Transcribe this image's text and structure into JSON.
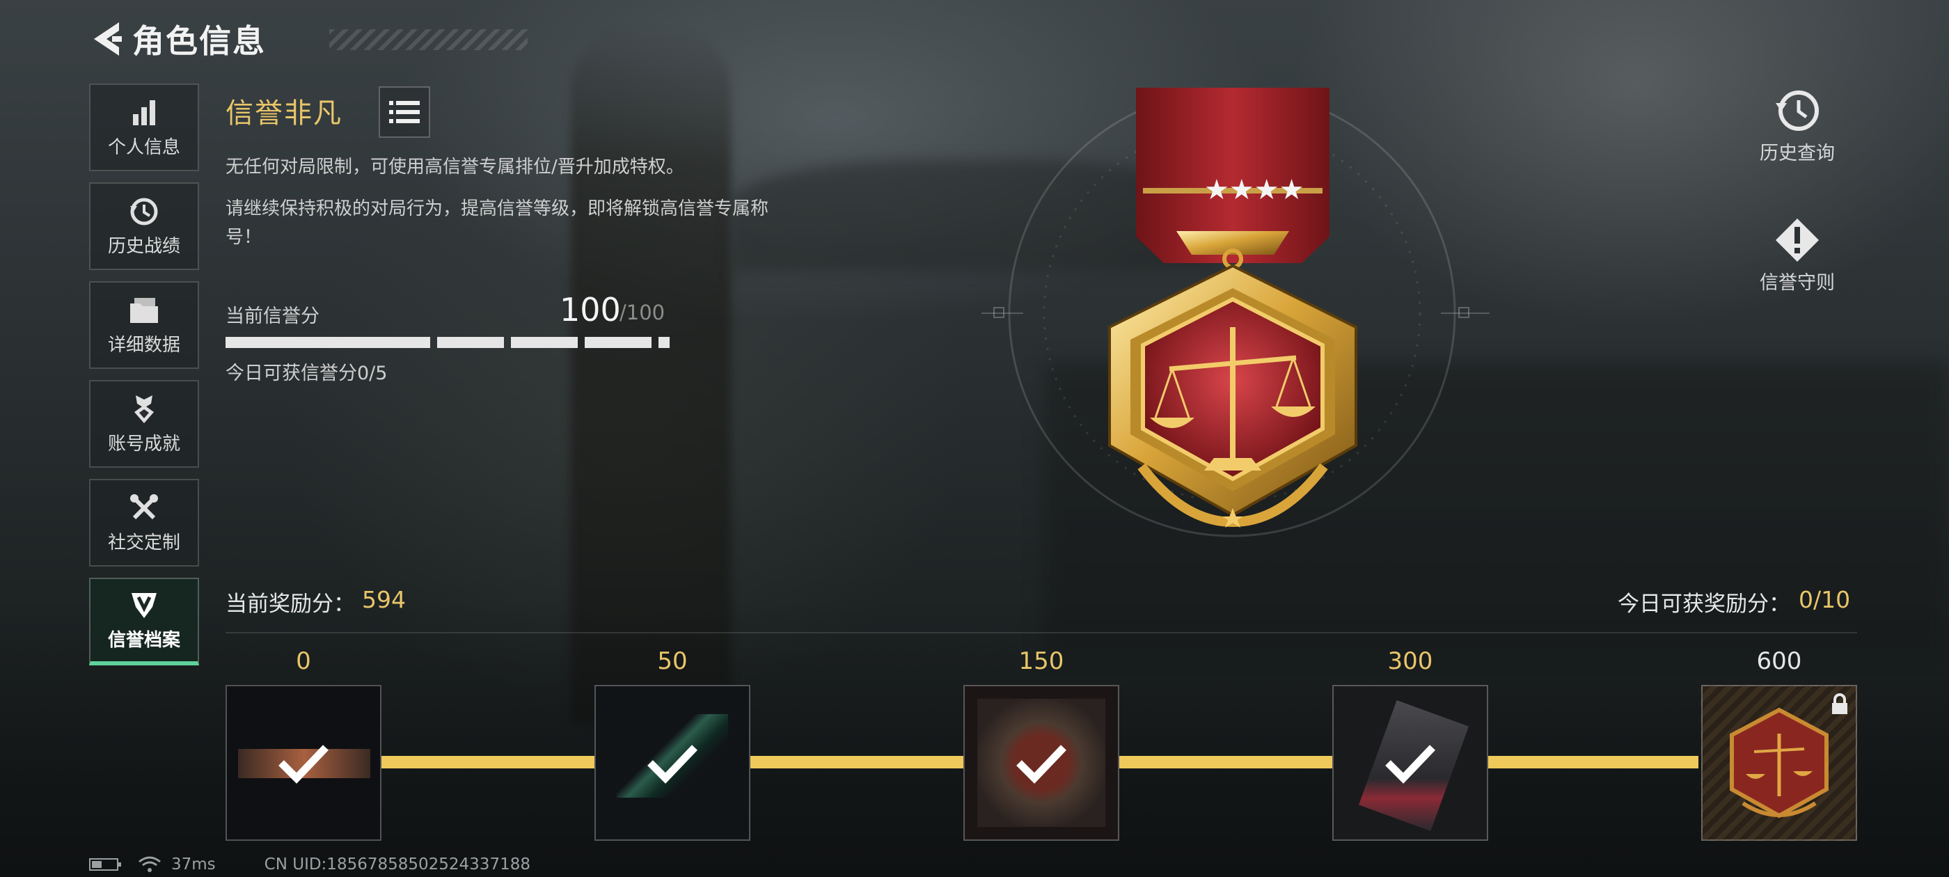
{
  "header": {
    "title": "角色信息"
  },
  "sidebar": {
    "items": [
      {
        "label": "个人信息",
        "icon": "bar-chart-icon"
      },
      {
        "label": "历史战绩",
        "icon": "history-icon"
      },
      {
        "label": "详细数据",
        "icon": "folder-icon"
      },
      {
        "label": "账号成就",
        "icon": "achievement-icon"
      },
      {
        "label": "社交定制",
        "icon": "tools-icon"
      },
      {
        "label": "信誉档案",
        "icon": "credit-shield-icon",
        "active": true
      }
    ]
  },
  "credit": {
    "rank_title": "信誉非凡",
    "desc1": "无任何对局限制，可使用高信誉专属排位/晋升加成特权。",
    "desc2": "请继续保持积极的对局行为，提高信誉等级，即将解锁高信誉专属称号！",
    "score_label": "当前信誉分",
    "score_value": "100",
    "score_max": "/100",
    "score_fraction": 1.0,
    "today_score": "今日可获信誉分0/5"
  },
  "actions": {
    "history": "历史查询",
    "rules": "信誉守则"
  },
  "rewards": {
    "current_label": "当前奖励分：",
    "current_value": "594",
    "today_label": "今日可获奖励分：",
    "today_value": "0/10",
    "milestones": [
      {
        "points": "0",
        "claimed": true
      },
      {
        "points": "50",
        "claimed": true
      },
      {
        "points": "150",
        "claimed": true
      },
      {
        "points": "300",
        "claimed": true
      },
      {
        "points": "600",
        "claimed": false,
        "locked": true
      }
    ]
  },
  "status": {
    "ping": "37ms",
    "uid": "CN UID:18567858502524337188"
  },
  "colors": {
    "gold": "#e9c66a",
    "active_tab": "#5fd19a",
    "track": "#efc95a"
  }
}
